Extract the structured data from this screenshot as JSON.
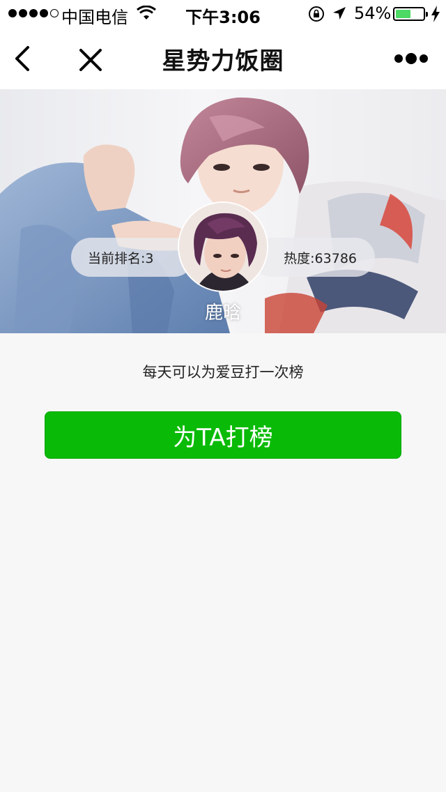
{
  "status_bar": {
    "carrier": "中国电信",
    "time": "下午3:06",
    "battery_percent": "54%",
    "battery_level": 0.54,
    "signal_bars_filled": 4,
    "signal_bars_total": 5
  },
  "nav": {
    "title": "星势力饭圈",
    "back_icon": "chevron-left-icon",
    "close_icon": "close-icon",
    "more_icon": "more-dots-icon"
  },
  "hero": {
    "rank_label": "当前排名:3",
    "heat_label": "热度:63786",
    "idol_name": "鹿晗"
  },
  "content": {
    "hint": "每天可以为爱豆打一次榜",
    "vote_button": "为TA打榜"
  },
  "colors": {
    "accent_green": "#09bb07",
    "battery_green": "#4cd964",
    "background": "#f7f7f7"
  }
}
